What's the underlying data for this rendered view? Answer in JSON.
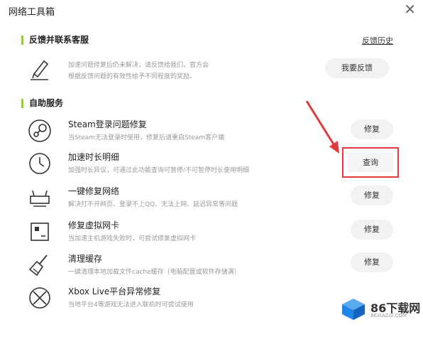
{
  "window": {
    "title": "网络工具箱"
  },
  "feedback": {
    "heading": "反馈并联系客服",
    "history_link": "反馈历史",
    "line1": "加速问题修复后仍未解决，请反馈给我们，官方会",
    "line2": "根据反馈问题的有效性给予不同程度的奖励。",
    "button": "我要反馈"
  },
  "self_service": {
    "heading": "自助服务",
    "items": [
      {
        "title": "Steam登录问题修复",
        "desc": "当Steam无法登录时使用，修复后请重启Steam客户端",
        "button": "修复",
        "icon": "steam-icon"
      },
      {
        "title": "加速时长明细",
        "desc": "加强时长异议，可通过此功能查询可暂停/不可暂停时长使用明细",
        "button": "查询",
        "icon": "clock-icon"
      },
      {
        "title": "一键修复网络",
        "desc": "解决打不开网页、登录不上QQ、无法上网、延迟异常等问题",
        "button": "修复",
        "icon": "router-icon"
      },
      {
        "title": "修复虚拟网卡",
        "desc": "当加速主机游戏失败时，可尝试修复虚拟网卡",
        "button": "修复",
        "icon": "network-card-icon"
      },
      {
        "title": "清理缓存",
        "desc": "一键清理本地加载文件cache缓存（电脑配置或软件存储满）",
        "button": "修复",
        "icon": "broom-icon"
      },
      {
        "title": "Xbox Live平台异常修复",
        "desc": "当地平台4等游戏无法进入联机时可尝试使用",
        "button": "",
        "icon": "xbox-icon"
      }
    ]
  },
  "watermark": {
    "brand": "86下载网",
    "sub": "86XIAZAI.COM"
  },
  "colors": {
    "accent": "#8fd128",
    "highlight": "#e03a3a",
    "logo_blue": "#1f86e8"
  }
}
